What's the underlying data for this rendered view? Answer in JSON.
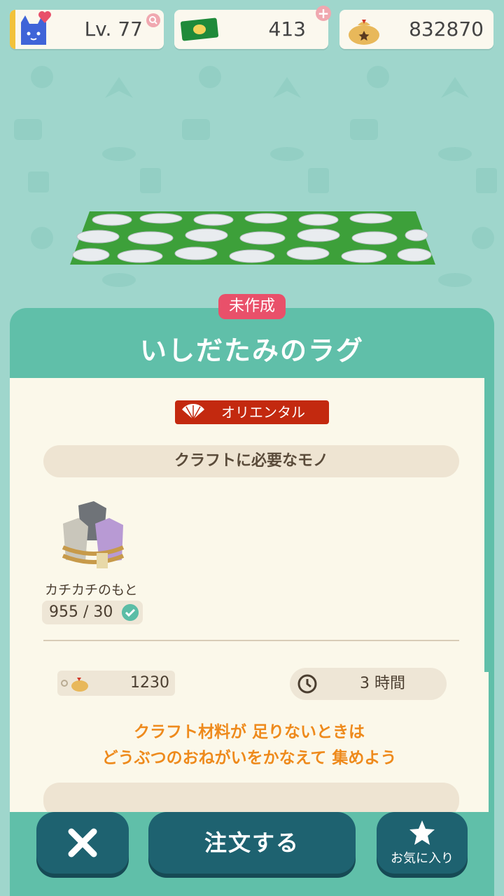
{
  "header": {
    "level_label": "Lv. 77",
    "tickets": "413",
    "bells": "832870"
  },
  "item": {
    "status_tag": "未作成",
    "name": "いしだたみのラグ",
    "theme": "オリエンタル"
  },
  "materials": {
    "section_title": "クラフトに必要なモノ",
    "items": [
      {
        "name": "カチカチのもと",
        "count": "955 / 30"
      }
    ]
  },
  "craft": {
    "bell_cost": "1230",
    "time": "3 時間"
  },
  "hint": {
    "line1": "クラフト材料が 足りないときは",
    "line2": "どうぶつのおねがいをかなえて 集めよう"
  },
  "buttons": {
    "order": "注文する",
    "favorite": "お気に入り"
  },
  "colors": {
    "panel": "#60bfa9",
    "status_tag": "#e9506a",
    "theme_tag": "#c3290f",
    "hint_text": "#ee8a1c",
    "button": "#1e6270"
  }
}
